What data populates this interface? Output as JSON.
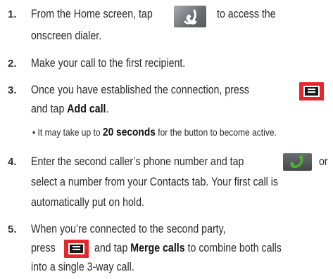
{
  "steps": [
    {
      "number": "1.",
      "line1_before": "From the Home screen, tap",
      "line1_after": "to access the",
      "line2": "onscreen dialer."
    },
    {
      "number": "2.",
      "line1": "Make your call to the first recipient."
    },
    {
      "number": "3.",
      "line1": "Once you have established the connection, press",
      "line2_before": "and tap",
      "line2_bold": "Add call",
      "line2_after": ".",
      "bullet_before": "• It may take up to",
      "bullet_bold": "20 seconds",
      "bullet_after": "for the button to become active."
    },
    {
      "number": "4.",
      "line1_before": "Enter the second caller’s phone number and tap",
      "line1_after": "or",
      "line2": "select a number from your Contacts tab. Your first call is",
      "line3": "automatically put on hold."
    },
    {
      "number": "5.",
      "line1": "When you’re connected to the second party,",
      "line2_before": "press",
      "line2_middle": "and tap",
      "line2_bold": "Merge calls",
      "line2_after": "to combine both calls",
      "line3": "into a single 3-way call."
    }
  ],
  "icons": {
    "phone_gray": "phone-icon",
    "phone_green": "phone-icon",
    "menu": "menu-key-icon",
    "menu_color": "#e4272c",
    "phone_green_color": "#4caf37"
  }
}
